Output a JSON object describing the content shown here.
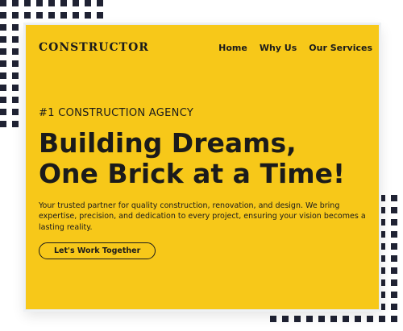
{
  "brand": {
    "name": "CONSTRUCTOR"
  },
  "nav": {
    "items": [
      {
        "label": "Home"
      },
      {
        "label": "Why Us"
      },
      {
        "label": "Our Services"
      }
    ]
  },
  "hero": {
    "eyebrow": "#1 CONSTRUCTION AGENCY",
    "headline_line1": "Building Dreams,",
    "headline_line2": "One Brick at a Time!",
    "description": "Your trusted partner for quality construction, renovation, and design. We bring expertise, precision, and dedication to every project, ensuring your vision becomes a lasting reality.",
    "cta_label": "Let's Work Together"
  },
  "colors": {
    "panel_background": "#f7c819",
    "text": "#1b1b1b",
    "decoration_dots": "#1f2233"
  }
}
